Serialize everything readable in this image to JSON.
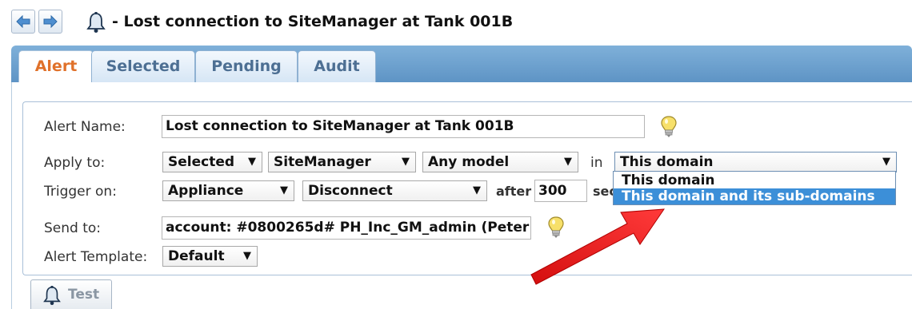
{
  "window": {
    "title": "- Lost connection to SiteManager at Tank 001B"
  },
  "tabs": [
    {
      "label": "Alert",
      "active": true
    },
    {
      "label": "Selected",
      "active": false
    },
    {
      "label": "Pending",
      "active": false
    },
    {
      "label": "Audit",
      "active": false
    }
  ],
  "form": {
    "alert_name": {
      "label": "Alert Name:",
      "value": "Lost connection to SiteManager at Tank 001B"
    },
    "apply_to": {
      "label": "Apply to:",
      "scope": "Selected",
      "product": "SiteManager",
      "model": "Any model",
      "in_label": "in",
      "domain": "This domain",
      "domain_options": [
        "This domain",
        "This domain and its sub-domains"
      ],
      "highlighted_option": "This domain and its sub-domains"
    },
    "trigger_on": {
      "label": "Trigger on:",
      "source": "Appliance",
      "event": "Disconnect",
      "after_label": "after",
      "after_value": "300",
      "unit_partial": "sec"
    },
    "send_to": {
      "label": "Send to:",
      "value": "account: #0800265d# PH_Inc_GM_admin (Peter Ha"
    },
    "alert_template": {
      "label": "Alert Template:",
      "value": "Default"
    }
  },
  "buttons": {
    "test_label": "Test"
  },
  "colors": {
    "active_tab_text": "#e0712a",
    "tab_text": "#4d6f93",
    "tab_strip": "#6a9fcf",
    "highlight": "#3c8fd8",
    "annotation_arrow": "#e81818"
  },
  "icons": [
    "back-arrow-icon",
    "forward-arrow-icon",
    "bell-icon",
    "lightbulb-icon",
    "dropdown-arrow-icon"
  ]
}
